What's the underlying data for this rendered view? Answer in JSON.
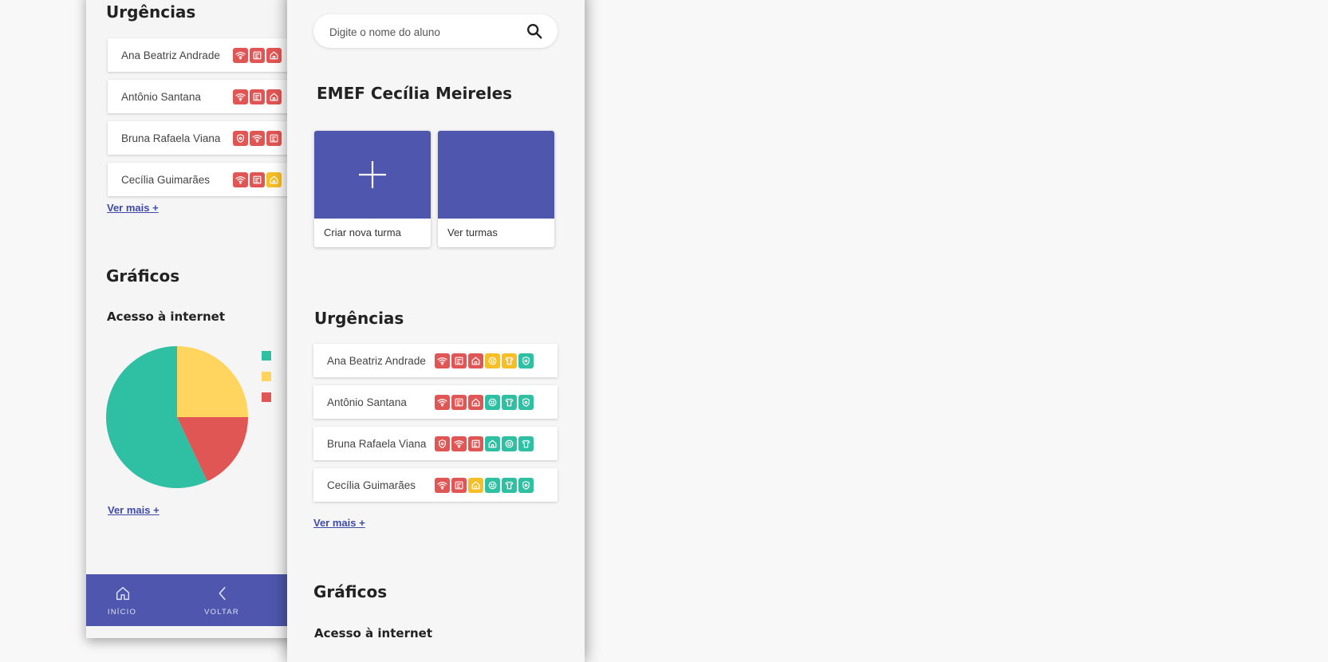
{
  "colors": {
    "red": "#e05654",
    "yellow": "#f6be27",
    "teal": "#2fbfa3",
    "indigo": "#4e57ad",
    "pie_yellow": "#ffd55f"
  },
  "back": {
    "urgencias_title": "Urgências",
    "students": [
      {
        "name": "Ana Beatriz Andrade",
        "badges": [
          [
            "wifi-icon",
            "red"
          ],
          [
            "calendar-icon",
            "red"
          ],
          [
            "home-icon",
            "red"
          ]
        ]
      },
      {
        "name": "Antônio Santana",
        "badges": [
          [
            "wifi-icon",
            "red"
          ],
          [
            "calendar-icon",
            "red"
          ],
          [
            "home-icon",
            "red"
          ]
        ]
      },
      {
        "name": "Bruna Rafaela Viana",
        "badges": [
          [
            "shield-icon",
            "red"
          ],
          [
            "wifi-icon",
            "red"
          ],
          [
            "calendar-icon",
            "red"
          ]
        ]
      },
      {
        "name": "Cecília Guimarães",
        "badges": [
          [
            "wifi-icon",
            "red"
          ],
          [
            "calendar-icon",
            "red"
          ],
          [
            "home-icon",
            "yellow"
          ]
        ]
      }
    ],
    "ver_mais_urg": "Ver mais +",
    "graficos_title": "Gráficos",
    "chart_subtitle": "Acesso à internet",
    "ver_mais_graf": "Ver mais +",
    "nav": [
      {
        "label": "INÍCIO",
        "icon": "home-icon"
      },
      {
        "label": "VOLTAR",
        "icon": "chevron-left-icon"
      }
    ]
  },
  "front": {
    "search_placeholder": "Digite o nome do aluno",
    "school_name": "EMEF Cecília Meireles",
    "cards": [
      {
        "label": "Criar nova turma",
        "icon": "plus-icon"
      },
      {
        "label": "Ver turmas",
        "icon": ""
      }
    ],
    "urgencias_title": "Urgências",
    "students": [
      {
        "name": "Ana Beatriz Andrade",
        "badges": [
          [
            "wifi-icon",
            "red"
          ],
          [
            "calendar-icon",
            "red"
          ],
          [
            "home-icon",
            "red"
          ],
          [
            "smile-icon",
            "yellow"
          ],
          [
            "shirt-icon",
            "yellow"
          ],
          [
            "shield-icon",
            "teal"
          ]
        ]
      },
      {
        "name": "Antônio Santana",
        "badges": [
          [
            "wifi-icon",
            "red"
          ],
          [
            "calendar-icon",
            "red"
          ],
          [
            "home-icon",
            "red"
          ],
          [
            "smile-icon",
            "teal"
          ],
          [
            "shirt-icon",
            "teal"
          ],
          [
            "shield-icon",
            "teal"
          ]
        ]
      },
      {
        "name": "Bruna Rafaela Viana",
        "badges": [
          [
            "shield-icon",
            "red"
          ],
          [
            "wifi-icon",
            "red"
          ],
          [
            "calendar-icon",
            "red"
          ],
          [
            "home-icon",
            "teal"
          ],
          [
            "smile-icon",
            "teal"
          ],
          [
            "shirt-icon",
            "teal"
          ]
        ]
      },
      {
        "name": "Cecília Guimarães",
        "badges": [
          [
            "wifi-icon",
            "red"
          ],
          [
            "calendar-icon",
            "red"
          ],
          [
            "home-icon",
            "yellow"
          ],
          [
            "smile-icon",
            "teal"
          ],
          [
            "shirt-icon",
            "teal"
          ],
          [
            "shield-icon",
            "teal"
          ]
        ]
      }
    ],
    "ver_mais": "Ver mais +",
    "graficos_title": "Gráficos",
    "chart_subtitle": "Acesso à internet"
  },
  "chart_data": {
    "type": "pie",
    "title": "Acesso à internet",
    "slices": [
      {
        "color": "#ffd55f",
        "value": 25
      },
      {
        "color": "#e05654",
        "value": 18
      },
      {
        "color": "#2fbfa3",
        "value": 57
      }
    ]
  }
}
